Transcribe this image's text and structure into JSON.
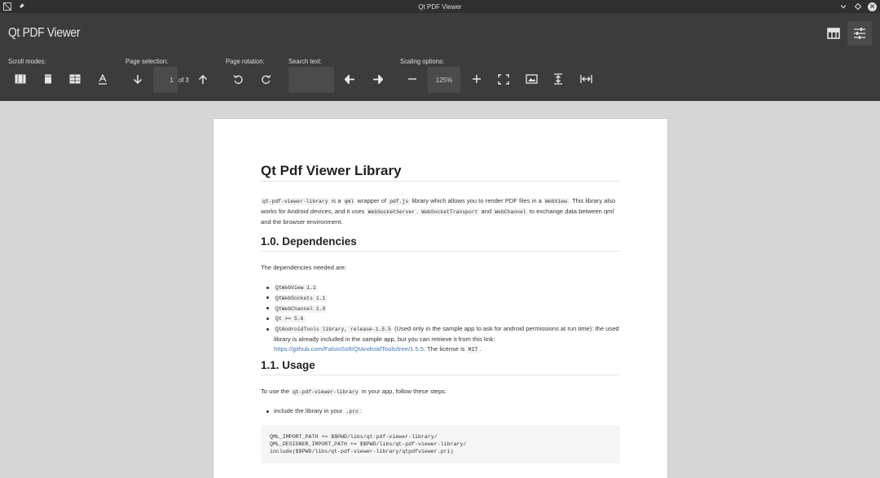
{
  "window": {
    "title": "Qt PDF Viewer"
  },
  "app": {
    "title": "Qt PDF Viewer",
    "icons": {
      "layout": "table-layout-icon",
      "settings": "sliders-icon"
    }
  },
  "toolbar": {
    "scroll_modes_label": "Scroll modes:",
    "page_selection_label": "Page selection:",
    "page_rotation_label": "Page rotation:",
    "search_text_label": "Search text:",
    "scaling_options_label": "Scaling options:",
    "page_number": "1",
    "page_total": "of 3",
    "search_value": "",
    "zoom_value": "125%"
  },
  "document": {
    "title": "Qt Pdf Viewer Library",
    "intro": {
      "c1": "qt-pdf-viewer-library",
      "t1": " is a ",
      "c2": "qml",
      "t2": " wrapper of ",
      "c3": "pdf.js",
      "t3": " library which allows you to render PDF files in a ",
      "c4": "WebView",
      "t4": ". This library also works for Android devices, and it uses ",
      "c5": "WebSocketServer",
      "t5": ", ",
      "c6": "WebSocketTransport",
      "t6": " and ",
      "c7": "WebChannel",
      "t7": " to exchange data between qml and the browser environment."
    },
    "deps_heading": "1.0. Dependencies",
    "deps_text": "The dependencies needed are:",
    "deps": [
      "QtWebView 1.1",
      "QtWebSockets 1.1",
      "QtWebChannel 1.0",
      "Qt >= 5.6"
    ],
    "deps_last": {
      "code": "QtAndroidTools library, release-1.5.5",
      "text": " (Used only in the sample app to ask for android permissions at run time): the used library is already included in the sample app, but you can retrieve it from this link: ",
      "link": "https://github.com/FalsinSoft/QtAndroidTools/tree/1.5.5",
      "text2": ". The license is ",
      "license": "MIT",
      "text3": "."
    },
    "usage_heading": "1.1. Usage",
    "usage_text_a": "To use the ",
    "usage_code": "qt-pdf-viewer-library",
    "usage_text_b": " in your app, follow these steps:",
    "usage_step_a": "include the library in your ",
    "usage_step_code": ".pro",
    "usage_step_b": ":",
    "code_block": "QML_IMPORT_PATH += $$PWD/libs/qt-pdf-viewer-library/\nQML_DESIGNER_IMPORT_PATH += $$PWD/libs/qt-pdf-viewer-library/\ninclude($$PWD/libs/qt-pdf-viewer-library/qtpdfviewer.pri)"
  }
}
